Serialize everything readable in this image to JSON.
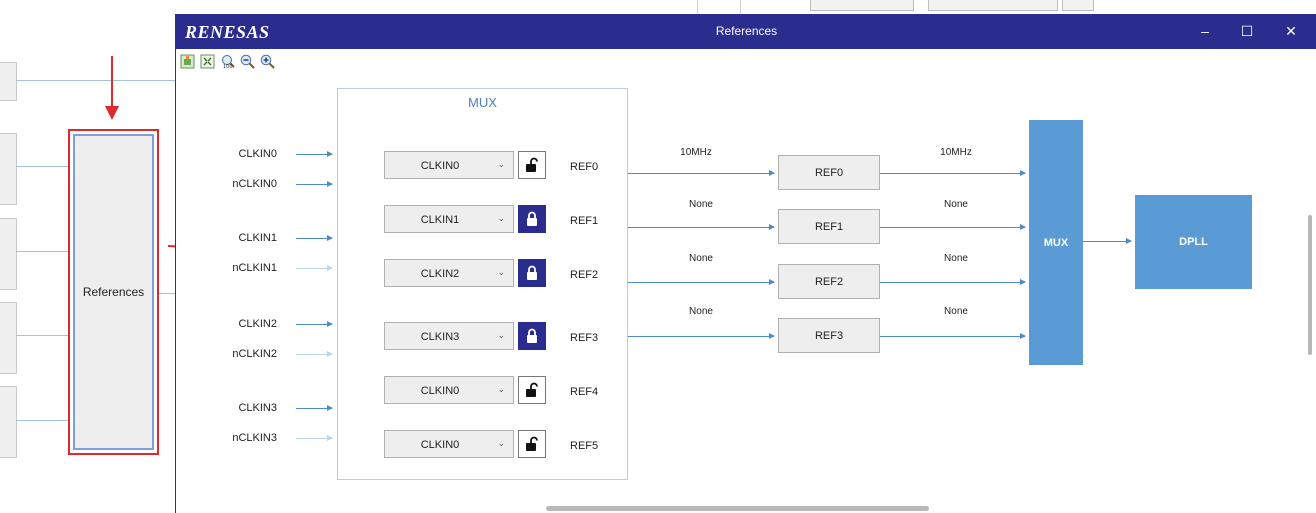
{
  "background": {
    "reference_block_label": "References"
  },
  "window": {
    "logo_text": "RENESAS",
    "title": "References",
    "controls": {
      "minimize": "–",
      "maximize": "☐",
      "close": "✕"
    }
  },
  "toolbar": {
    "icons": [
      "fit-to-window-icon",
      "expand-icon",
      "zoom-100-icon",
      "zoom-out-icon",
      "zoom-in-icon"
    ]
  },
  "diagram": {
    "mux_title": "MUX",
    "inputs": [
      "CLKIN0",
      "nCLKIN0",
      "CLKIN1",
      "nCLKIN1",
      "CLKIN2",
      "nCLKIN2",
      "CLKIN3",
      "nCLKIN3"
    ],
    "selectors": [
      {
        "value": "CLKIN0",
        "locked": false,
        "output": "REF0"
      },
      {
        "value": "CLKIN1",
        "locked": true,
        "output": "REF1"
      },
      {
        "value": "CLKIN2",
        "locked": true,
        "output": "REF2"
      },
      {
        "value": "CLKIN3",
        "locked": true,
        "output": "REF3"
      },
      {
        "value": "CLKIN0",
        "locked": false,
        "output": "REF4"
      },
      {
        "value": "CLKIN0",
        "locked": false,
        "output": "REF5"
      }
    ],
    "ref_blocks": [
      {
        "label": "REF0",
        "in_freq": "10MHz",
        "out_freq": "10MHz"
      },
      {
        "label": "REF1",
        "in_freq": "None",
        "out_freq": "None"
      },
      {
        "label": "REF2",
        "in_freq": "None",
        "out_freq": "None"
      },
      {
        "label": "REF3",
        "in_freq": "None",
        "out_freq": "None"
      }
    ],
    "mux2_label": "MUX",
    "dpll_label": "DPLL"
  },
  "colors": {
    "titlebar": "#2a2c8e",
    "block_blue": "#5b9bd5",
    "lock_active": "#2a2c8e",
    "highlight_red": "#e0292e"
  }
}
